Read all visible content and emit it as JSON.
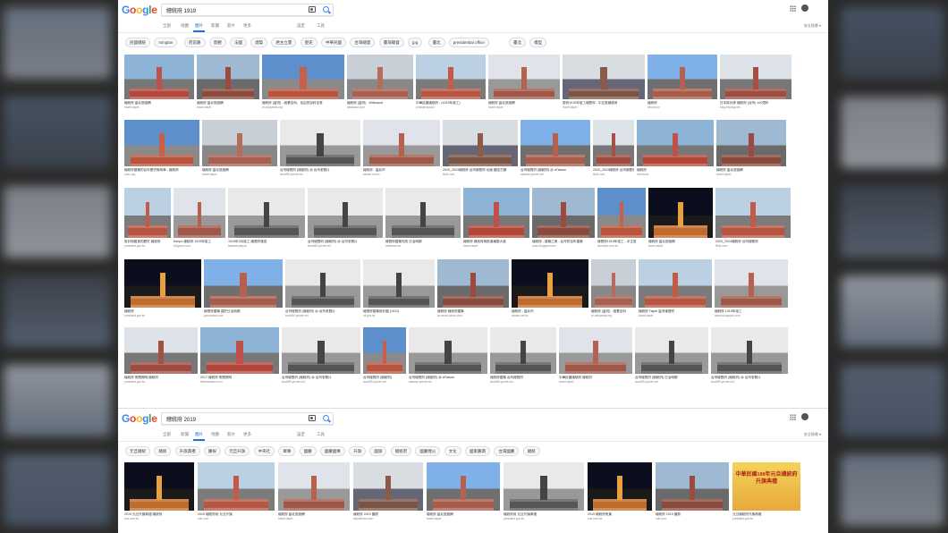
{
  "screen1": {
    "logo": "Google",
    "query": "總統府 1919",
    "tabs": [
      {
        "label": "全部",
        "active": false
      },
      {
        "label": "地圖",
        "active": false
      },
      {
        "label": "圖片",
        "active": true
      },
      {
        "label": "新聞",
        "active": false
      },
      {
        "label": "影片",
        "active": false
      },
      {
        "label": "更多",
        "active": false
      }
    ],
    "settings": "設定",
    "tools": "工具",
    "safesearch": "安全搜尋 ▾",
    "chips": [
      "民國總統",
      "mingtan",
      "府前路",
      "景觀",
      "法國",
      "建築",
      "君主立憲",
      "歷史",
      "中華民國",
      "台灣總督",
      "臺灣總督",
      "jpg",
      "臺北",
      "presidential office",
      "臺北",
      "模型"
    ],
    "rows": [
      [
        {
          "caption": "總統府 臺北旅遊網",
          "source": "travel.taipei"
        },
        {
          "caption": "總統府 臺北旅遊網",
          "source": "travel.taipei"
        },
        {
          "caption": "總統府 (臺灣) - 維基百科，自由的百科全書",
          "source": "zh.wikipedia.org"
        },
        {
          "caption": "總統府 (臺灣) - Wikiwand",
          "source": "wikiwand.com"
        },
        {
          "caption": "中華民國總統府 - (1919年竣工)",
          "source": "presidentpa.tw"
        },
        {
          "caption": "總統府 臺北旅遊網",
          "source": "travel.taipei"
        },
        {
          "caption": "慶祝1919年竣工總督府 - 中正區總統府",
          "source": "travel.taipei"
        },
        {
          "caption": "總統府",
          "source": "hiroshi.tw"
        },
        {
          "caption": "日本設計師 總統府 (台灣) 100週年",
          "source": "blog.ettoday.net"
        }
      ],
      [
        {
          "caption": "總統府建築的百年歷史與故事 - 總統府",
          "source": "ocec.org"
        },
        {
          "caption": "總統府 臺北旅遊網",
          "source": "travel.taipei"
        },
        {
          "caption": "台灣總督府 (總統府) @ 台灣老照片",
          "source": "twold59.pixnet.net"
        },
        {
          "caption": "總統府 - 臺北市",
          "source": "taiwan.net.tw"
        },
        {
          "caption": "2020_2024總統府 台灣總督府 北面 國定古蹟",
          "source": "flickr.com"
        },
        {
          "caption": "台灣總督府 (總統府) @ aTaiwan",
          "source": "ataiwan.pixnet.net"
        },
        {
          "caption": "2020_2024總統府 台灣總督府",
          "source": "flickr.com"
        },
        {
          "caption": "總統府",
          "source": "hiroshi.tw"
        },
        {
          "caption": "總統府 臺北旅遊網",
          "source": "travel.taipei"
        }
      ],
      [
        {
          "caption": "設計與建造的歷史 總統府",
          "source": "president.gov.tw"
        },
        {
          "caption": "Kanpo 總統府 1919年竣工",
          "source": "blogspot.com"
        },
        {
          "caption": "1919年3月竣工 總督府落成",
          "source": "taiwantoday.tw"
        },
        {
          "caption": "台灣總督府 (總統府) @ 台灣老照片",
          "source": "twold59.pixnet.net"
        },
        {
          "caption": "總督府建築完成 日治時期",
          "source": "artsnews.tw"
        },
        {
          "caption": "總統府 總統府與凱達格蘭大道",
          "source": "travel.taipei"
        },
        {
          "caption": "總統府 - 建築之美 - 台灣的百年建築",
          "source": "ocac.blogspot.com"
        },
        {
          "caption": "總督府1919年竣工 - 中正區",
          "source": "hiroshiot.com.tw"
        },
        {
          "caption": "總統府 臺北旅遊網",
          "source": "travel.taipei"
        },
        {
          "caption": "2020_2024總統府 台灣總督府",
          "source": "flickr.com"
        }
      ],
      [
        {
          "caption": "總統府",
          "source": "president.gov.tw"
        },
        {
          "caption": "總督府建築 建於日治時期",
          "source": "gooonews.com"
        },
        {
          "caption": "台灣總督府 (總統府) @ 台灣老照片",
          "source": "twold59.pixnet.net"
        },
        {
          "caption": "總督府建築設計圖 (1912)",
          "source": "ntl.gov.tw"
        },
        {
          "caption": "總統府 總統府建築",
          "source": "tw.news.yahoo.com"
        },
        {
          "caption": "總統府 - 臺北市",
          "source": "taiwan.net.tw"
        },
        {
          "caption": "總統府 (臺灣) - 維基百科",
          "source": "zh.wikipedia.org"
        },
        {
          "caption": "總統府 Taipei 臺灣總督府",
          "source": "travel.taipei"
        },
        {
          "caption": "總統府 1919年竣工",
          "source": "taipeit.blogspot.com"
        }
      ],
      [
        {
          "caption": "總統府 夜間照明 總統府",
          "source": "president.gov.tw"
        },
        {
          "caption": "2017 總統府 夜間照明",
          "source": "thenewslens.com"
        },
        {
          "caption": "台灣總督府 (總統府) @ 台灣老照片",
          "source": "twold59.pixnet.net"
        },
        {
          "caption": "台灣總督府 (總統府)",
          "source": "twold59.pixnet.net"
        },
        {
          "caption": "台灣總督府 (總統府) @ aTaiwan",
          "source": "ataiwan.pixnet.net"
        },
        {
          "caption": "總統府建築 台灣總督府",
          "source": "twold59.pixnet.net"
        },
        {
          "caption": "中華民國總統府 總統府",
          "source": "travel.taipei"
        },
        {
          "caption": "台灣總督府 (總統府) 日治時期",
          "source": "twold59.pixnet.net"
        },
        {
          "caption": "台灣總督府 (總統府) @ 台灣老照片",
          "source": "twold59.pixnet.net"
        }
      ]
    ]
  },
  "screen2": {
    "logo": "Google",
    "query": "總統府 2019",
    "tabs": [
      {
        "label": "全部",
        "active": false
      },
      {
        "label": "新聞",
        "active": false
      },
      {
        "label": "圖片",
        "active": true
      },
      {
        "label": "地圖",
        "active": false
      },
      {
        "label": "影片",
        "active": false
      },
      {
        "label": "更多",
        "active": false
      }
    ],
    "settings": "設定",
    "tools": "工具",
    "safesearch": "安全搜尋 ▾",
    "chips": [
      "元旦總統",
      "總統",
      "升旗典禮",
      "慶祝",
      "元旦升旗",
      "中央社",
      "軍樂",
      "國慶",
      "國慶國樂",
      "升旗",
      "國旗",
      "總統府",
      "國慶煙火",
      "文化",
      "國家慶典",
      "台灣國慶",
      "總統"
    ],
    "row": [
      {
        "caption": "2019 元旦升旗典禮 總統府",
        "source": "cna.com.tw"
      },
      {
        "caption": "2019 總統府前 元旦升旗",
        "source": "udn.com"
      },
      {
        "caption": "總統府 臺北旅遊網",
        "source": "travel.taipei"
      },
      {
        "caption": "總統府 2019 國慶",
        "source": "taipeitimes.com"
      },
      {
        "caption": "總統府 臺北旅遊網",
        "source": "travel.taipei"
      },
      {
        "caption": "總統府前 元旦升旗典禮",
        "source": "president.gov.tw"
      },
      {
        "caption": "2019 總統府夜景",
        "source": "cna.com.tw"
      },
      {
        "caption": "總統府 2019 國慶",
        "source": "udn.com"
      },
      {
        "caption": "元旦總統府升旗典禮",
        "source": "president.gov.tw"
      }
    ],
    "banner_text": "中華民國108年元旦總統府升旗典禮"
  },
  "colors": {
    "google": [
      "#4285f4",
      "#ea4335",
      "#fbbc05",
      "#4285f4",
      "#34a853",
      "#ea4335"
    ],
    "link": "#1a73e8",
    "backdrop": "#2a2a2a"
  }
}
